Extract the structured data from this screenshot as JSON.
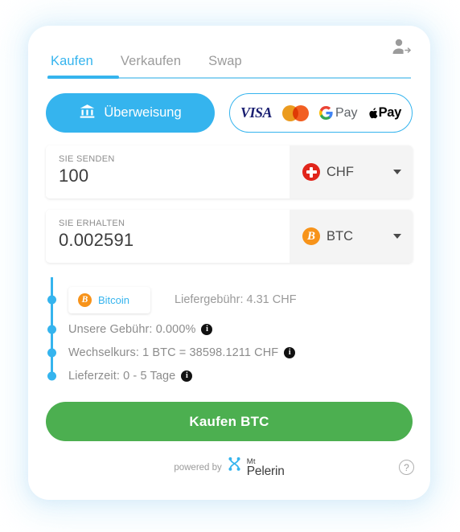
{
  "tabs": [
    {
      "label": "Kaufen",
      "active": true
    },
    {
      "label": "Verkaufen",
      "active": false
    },
    {
      "label": "Swap",
      "active": false
    }
  ],
  "account": {
    "icon": "person-add-icon"
  },
  "payment_methods": {
    "bank": {
      "label": "Überweisung",
      "icon": "bank-icon",
      "selected": true
    },
    "cards": {
      "visa_label": "VISA",
      "mastercard_label": "mastercard-icon",
      "gpay_g": "G",
      "gpay_label": "Pay",
      "apple_symbol": "",
      "apple_label": "Pay",
      "selected": false
    }
  },
  "send": {
    "label": "SIE SENDEN",
    "value": "100",
    "placeholder": "0",
    "currency": "CHF",
    "currency_icon": "swiss-flag-icon"
  },
  "receive": {
    "label": "SIE ERHALTEN",
    "value": "0.002591",
    "placeholder": "0",
    "currency": "BTC",
    "currency_icon": "bitcoin-icon"
  },
  "details": {
    "network_chip": {
      "label": "Bitcoin",
      "icon": "bitcoin-icon"
    },
    "delivery_fee": "Liefergebühr: 4.31 CHF",
    "our_fee": "Unsere Gebühr: 0.000%",
    "exchange_rate": "Wechselkurs: 1 BTC = 38598.1211 CHF",
    "delivery_time": "Lieferzeit: 0 - 5 Tage",
    "info_glyph": "i"
  },
  "cta": {
    "label": "Kaufen BTC"
  },
  "footer": {
    "powered_by": "powered by",
    "brand_top": "Mt",
    "brand_bottom": "Pelerin",
    "logo_icon": "mt-pelerin-logo-icon",
    "help_glyph": "?"
  },
  "colors": {
    "accent": "#35b4ee",
    "cta_green": "#4caf50",
    "bitcoin_orange": "#f7931a",
    "swiss_red": "#e1251b"
  }
}
